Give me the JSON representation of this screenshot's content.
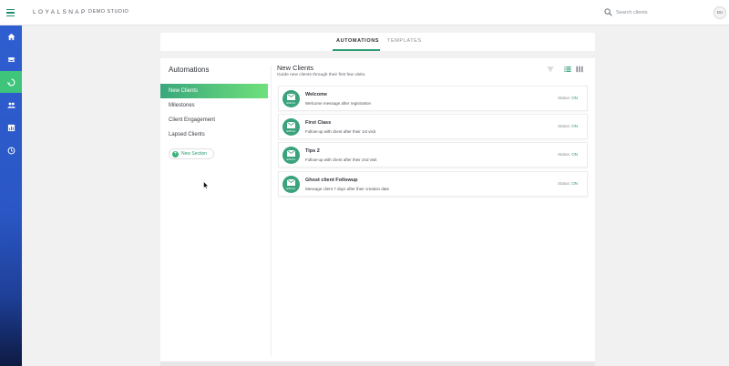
{
  "app": {
    "brand": "LOYALSNAP",
    "studio": "DEMO STUDIO",
    "user_initials": "DU"
  },
  "search": {
    "placeholder": "Search clients"
  },
  "sidebar": {
    "items": [
      {
        "icon": "home-icon",
        "active": false
      },
      {
        "icon": "inbox-icon",
        "active": false
      },
      {
        "icon": "automation-icon",
        "active": true
      },
      {
        "icon": "people-icon",
        "active": false
      },
      {
        "icon": "reports-icon",
        "active": false
      },
      {
        "icon": "history-icon",
        "active": false
      }
    ]
  },
  "tabs": [
    {
      "label": "AUTOMATIONS",
      "active": true
    },
    {
      "label": "TEMPLATES",
      "active": false
    }
  ],
  "sections": {
    "title": "Automations",
    "items": [
      {
        "label": "New Clients",
        "active": true
      },
      {
        "label": "Milestones",
        "active": false
      },
      {
        "label": "Client Engagement",
        "active": false
      },
      {
        "label": "Lapsed Clients",
        "active": false
      }
    ],
    "new_section_label": "New Section"
  },
  "list": {
    "title": "New Clients",
    "subtitle": "Guide new clients through their first few visits.",
    "badge_label": "EMAIL",
    "status_label": "Status:",
    "rows": [
      {
        "name": "Welcome",
        "description": "Welcome message after registration",
        "status": "ON"
      },
      {
        "name": "First Class",
        "description": "Follow-up with client after their 1st visit",
        "status": "ON"
      },
      {
        "name": "Tips 2",
        "description": "Follow-up with client after their 2nd visit",
        "status": "ON"
      },
      {
        "name": "Ghost client Followup",
        "description": "Message client 7 days after their creation date",
        "status": "ON"
      }
    ]
  },
  "colors": {
    "accent": "#2e9c73",
    "sidebar": "#2f5ed0",
    "active_nav": "#3fc47c",
    "active_section_start": "#3aa77c",
    "active_section_end": "#6fe07b"
  }
}
